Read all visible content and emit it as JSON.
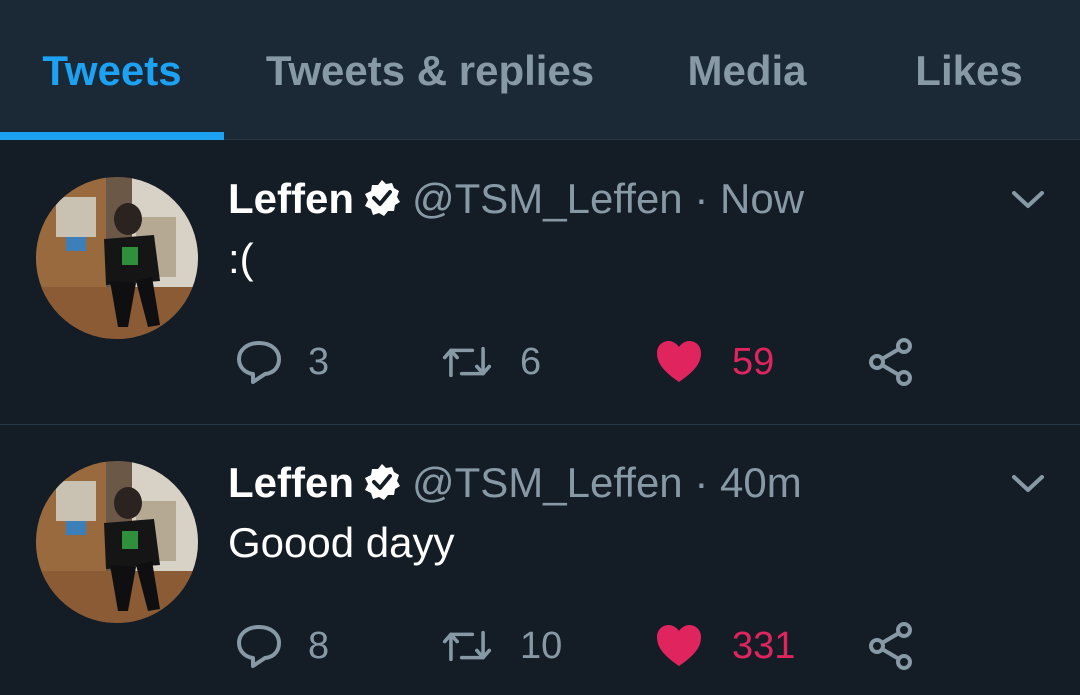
{
  "tabs": [
    {
      "label": "Tweets",
      "active": true
    },
    {
      "label": "Tweets & replies",
      "active": false
    },
    {
      "label": "Media",
      "active": false
    },
    {
      "label": "Likes",
      "active": false
    }
  ],
  "colors": {
    "accent": "#1da1f2",
    "like": "#e0245e",
    "muted": "#8899a6",
    "background": "#141d26"
  },
  "tweets": [
    {
      "name": "Leffen",
      "handle": "@TSM_Leffen",
      "separator": "·",
      "time": "Now",
      "text": ":(",
      "replies": "3",
      "retweets": "6",
      "likes": "59"
    },
    {
      "name": "Leffen",
      "handle": "@TSM_Leffen",
      "separator": "·",
      "time": "40m",
      "text": "Goood dayy",
      "replies": "8",
      "retweets": "10",
      "likes": "331"
    }
  ],
  "icons": {
    "verified": "verified-badge-icon",
    "menu": "chevron-down-icon",
    "reply": "reply-icon",
    "retweet": "retweet-icon",
    "like": "heart-icon",
    "share": "share-icon"
  }
}
